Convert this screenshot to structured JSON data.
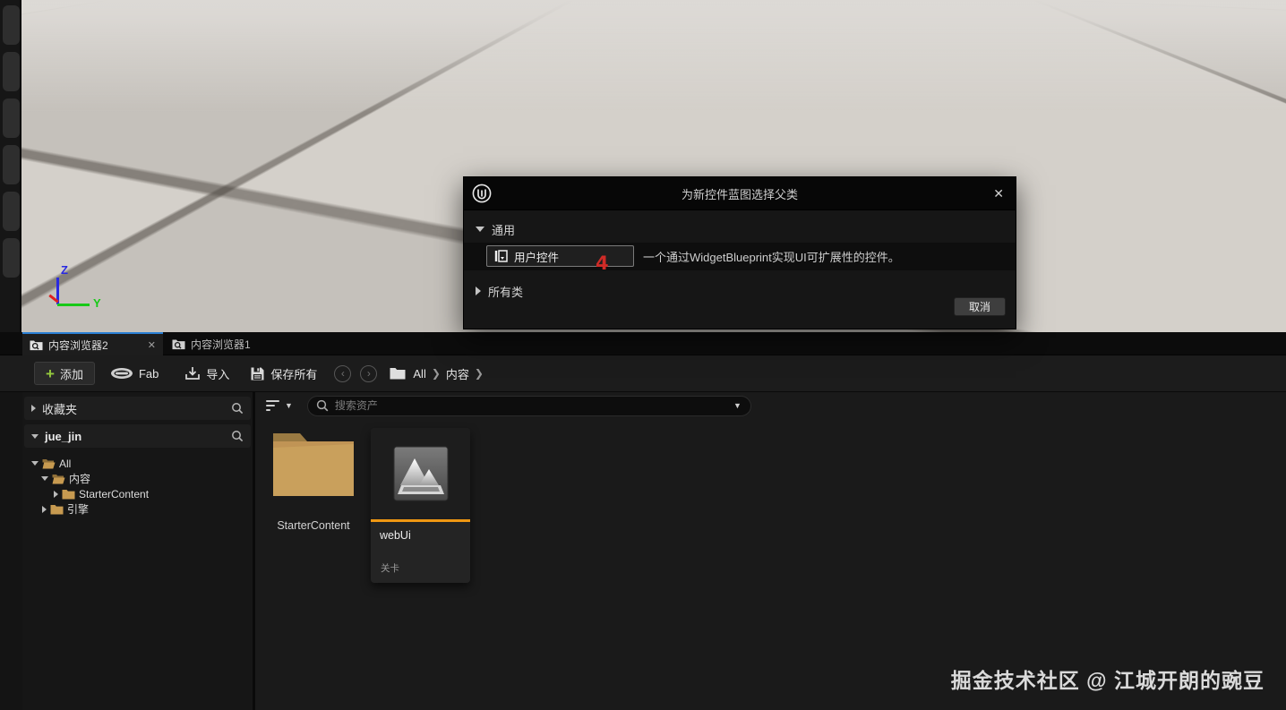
{
  "colors": {
    "accent_orange": "#ef9712",
    "tab_accent_blue": "#2a7fd4",
    "add_green": "#95c93d",
    "annotation_red": "#cf2b27"
  },
  "viewport": {
    "gizmo": {
      "z_label": "Z",
      "y_label": "Y"
    }
  },
  "dialog": {
    "title": "为新控件蓝图选择父类",
    "close_glyph": "✕",
    "section_common": "通用",
    "section_all_classes": "所有类",
    "option_label": "用户控件",
    "option_description": "一个通过WidgetBlueprint实现UI可扩展性的控件。",
    "annotation": "4",
    "cancel_label": "取消"
  },
  "content_browser": {
    "tabs": [
      {
        "label": "内容浏览器2",
        "close_glyph": "✕"
      },
      {
        "label": "内容浏览器1"
      }
    ],
    "toolbar": {
      "add_label": "添加",
      "fab_label": "Fab",
      "import_label": "导入",
      "save_all_label": "保存所有",
      "breadcrumb_root": "All",
      "breadcrumb_current": "内容"
    },
    "sidebar": {
      "favorites_label": "收藏夹",
      "collection_label": "jue_jin",
      "tree": [
        {
          "label": "All"
        },
        {
          "label": "内容"
        },
        {
          "label": "StarterContent"
        },
        {
          "label": "引擎"
        }
      ]
    },
    "search_placeholder": "搜索资产",
    "assets": {
      "folder_name": "StarterContent",
      "asset_name": "webUi",
      "asset_type": "关卡"
    }
  },
  "watermark": "掘金技术社区 @ 江城开朗的豌豆"
}
